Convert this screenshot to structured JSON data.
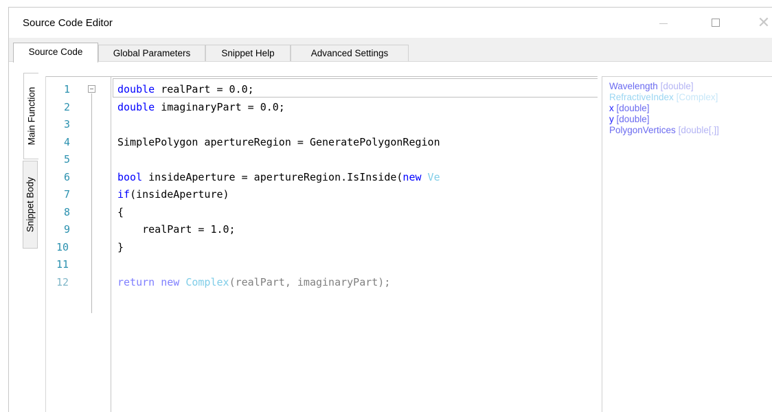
{
  "window": {
    "title": "Source Code Editor",
    "minimize_icon": "minimize-icon",
    "maximize_icon": "maximize-icon",
    "close_icon": "close-icon",
    "close_glyph": "✕"
  },
  "tabs": [
    {
      "label": "Source Code",
      "active": true
    },
    {
      "label": "Global Parameters",
      "active": false
    },
    {
      "label": "Snippet Help",
      "active": false
    },
    {
      "label": "Advanced Settings",
      "active": false
    }
  ],
  "vertical_tabs": [
    {
      "label": "Main Function",
      "active": true
    },
    {
      "label": "Snippet Body",
      "active": false
    }
  ],
  "editor": {
    "line_numbers": [
      "1",
      "2",
      "3",
      "4",
      "5",
      "6",
      "7",
      "8",
      "9",
      "10",
      "11",
      "12"
    ],
    "lines": {
      "l1_kw": "double",
      "l1_rest": " realPart = 0.0;",
      "l2_kw": "double",
      "l2_rest": " imaginaryPart = 0.0;",
      "l4_text": "SimplePolygon apertureRegion = GeneratePolygonRegion",
      "l6_kw": "bool",
      "l6_mid": " insideAperture = apertureRegion.IsInside(",
      "l6_kw2": "new",
      "l6_ty": "Ve",
      "l7_kw": "if",
      "l7_rest": "(insideAperture)",
      "l8_text": "{",
      "l9_text": "    realPart = 1.0;",
      "l10_text": "}",
      "l12_kw": "return",
      "l12_kw2": "new",
      "l12_ty": "Complex",
      "l12_rest": "(realPart, imaginaryPart);"
    }
  },
  "parameters": [
    {
      "name": "Wavelength",
      "type": "[double]"
    },
    {
      "name": "RefractiveIndex",
      "type": "[Complex]"
    },
    {
      "name": "x",
      "type": "[double]"
    },
    {
      "name": "y",
      "type": "[double]"
    },
    {
      "name": "PolygonVertices",
      "type": "[double[,]]"
    }
  ],
  "colors": {
    "keyword": "#0000ff",
    "type": "#2b91af",
    "line_number": "#2b91af",
    "param_name": "#6a6af0"
  }
}
